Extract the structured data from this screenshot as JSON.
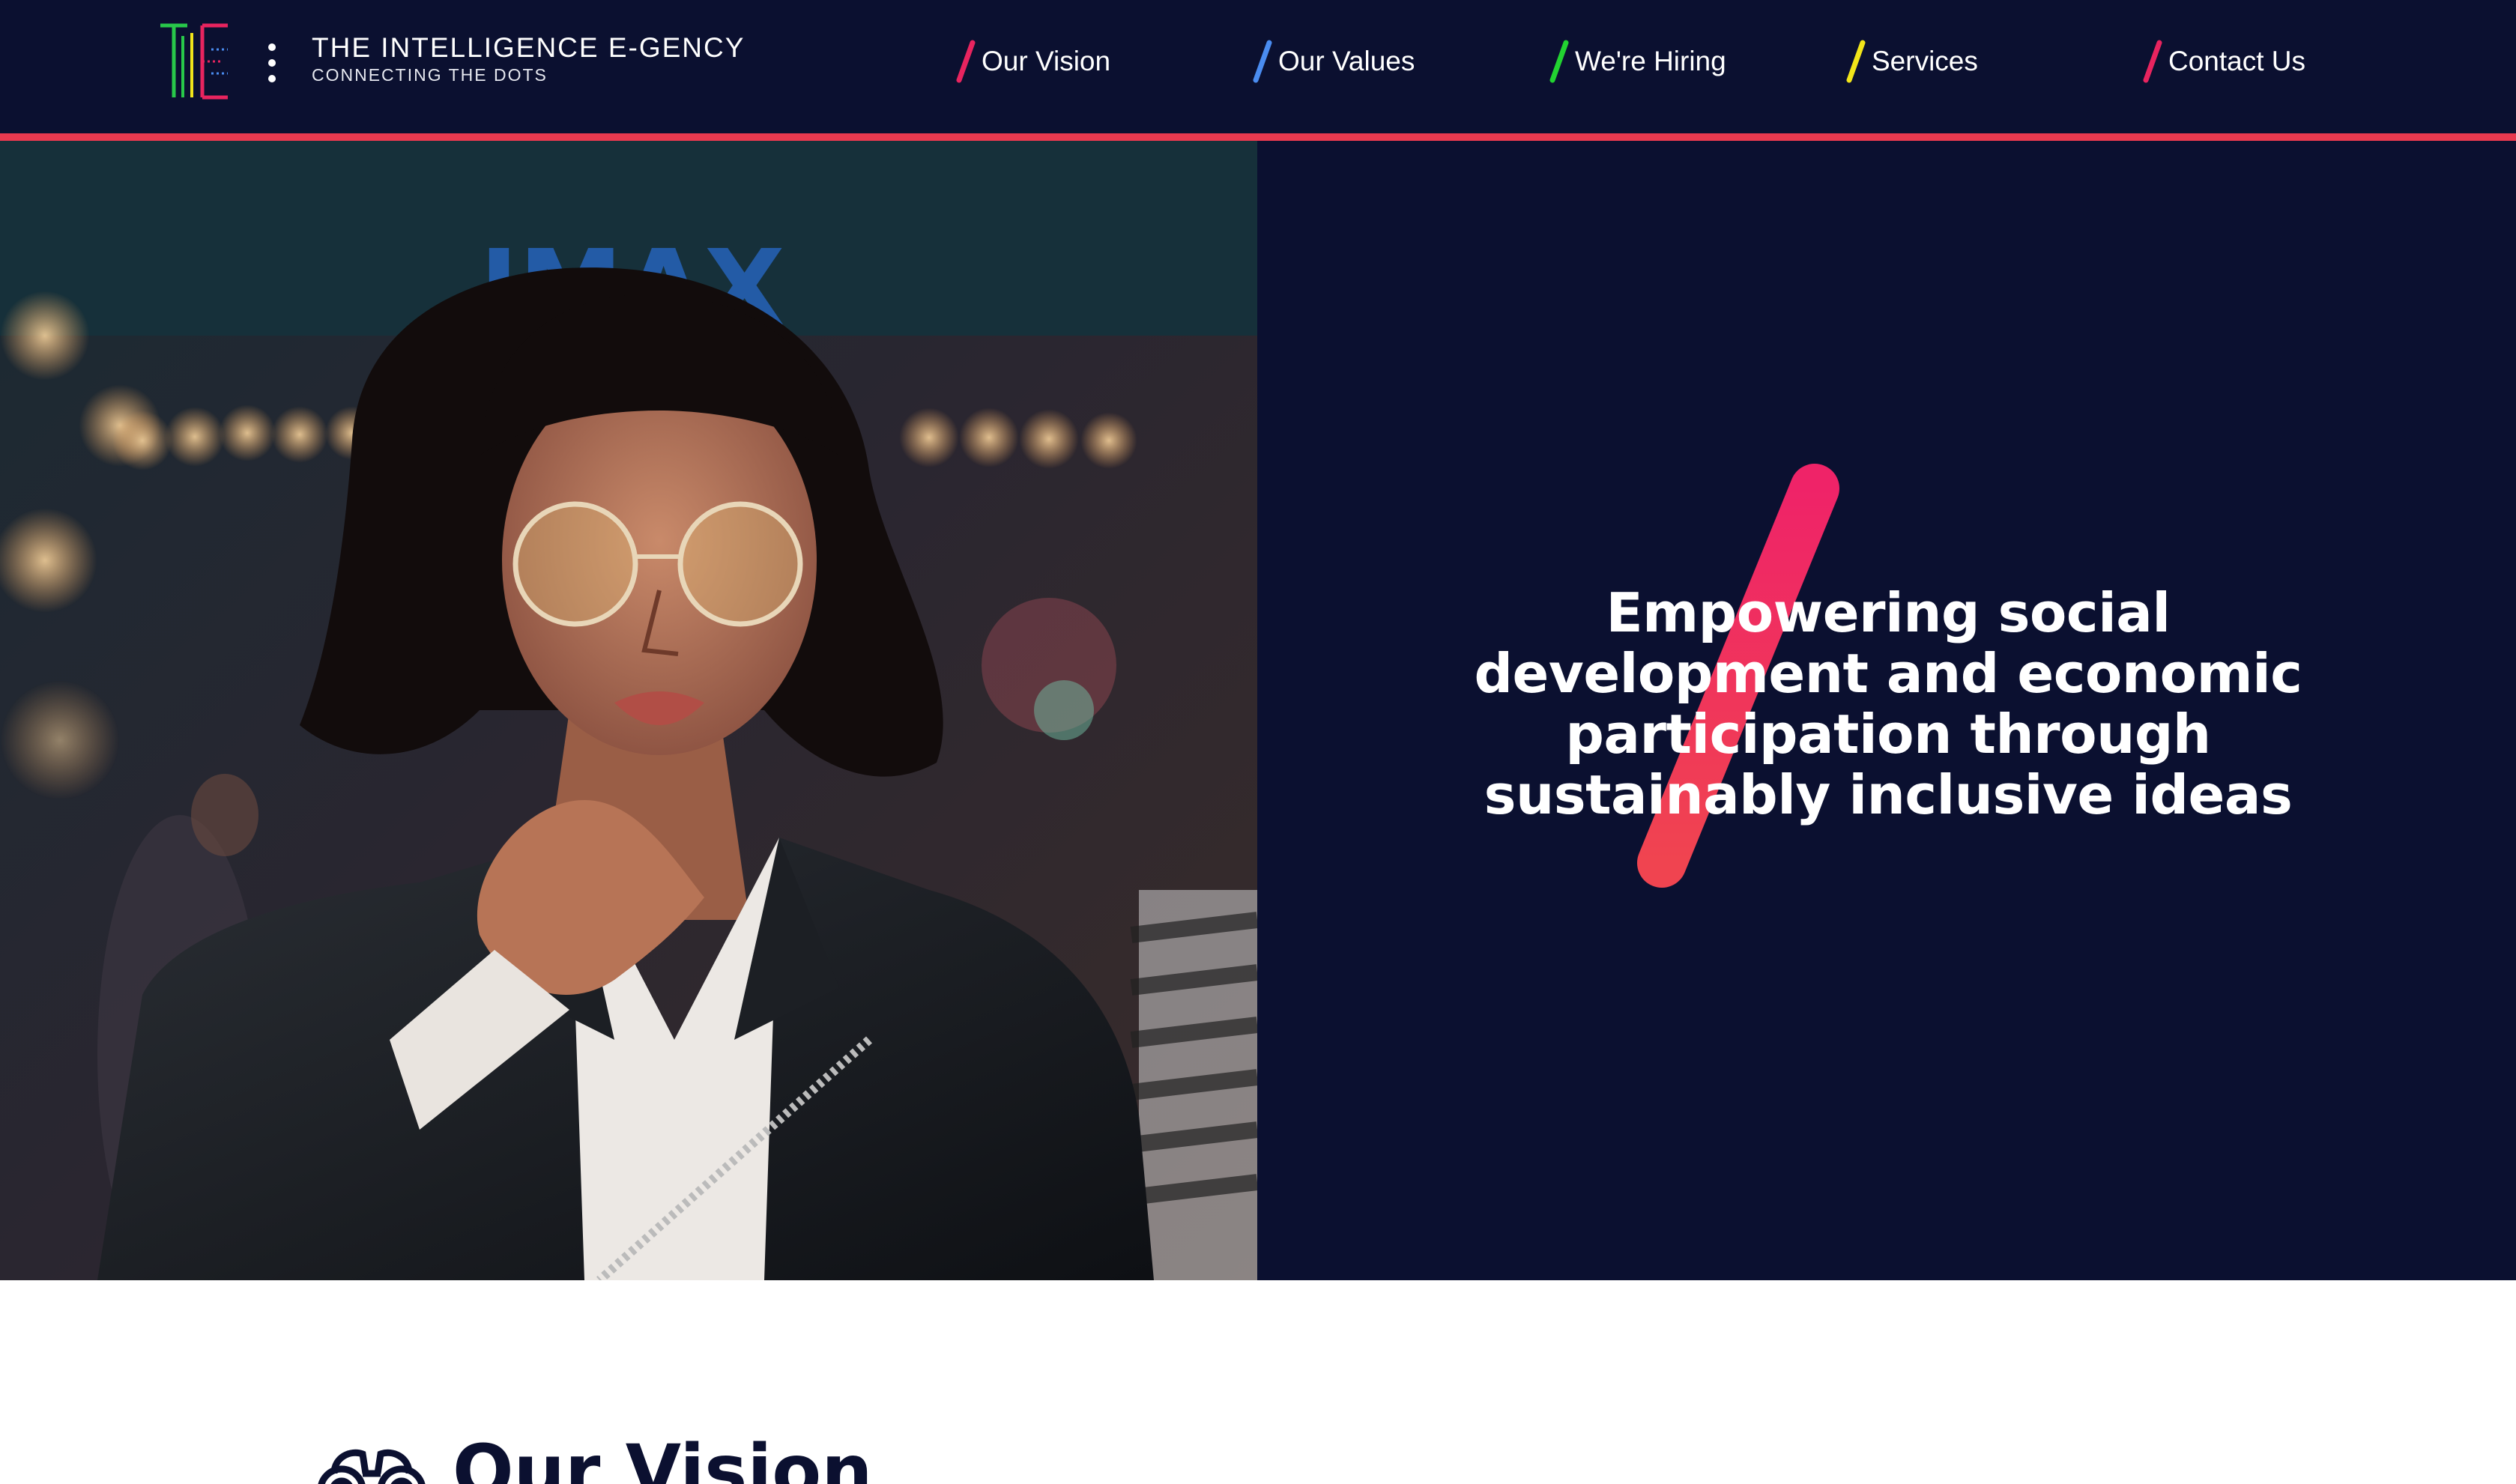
{
  "header": {
    "brand_name": "THE INTELLIGENCE E-GENCY",
    "brand_tagline": "CONNECTING THE DOTS",
    "logo_icon": "te-monogram-logo",
    "menu_icon": "vertical-dots-icon"
  },
  "nav": [
    {
      "label": "Our Vision",
      "color": "#e8245f"
    },
    {
      "label": "Our Values",
      "color": "#4a8cf0"
    },
    {
      "label": "We're Hiring",
      "color": "#22d331"
    },
    {
      "label": "Services",
      "color": "#f2e51a"
    },
    {
      "label": "Contact Us",
      "color": "#e8245f"
    }
  ],
  "hero": {
    "headline_lines": [
      "Empowering social",
      "development and economic",
      "participation through",
      "sustainably inclusive ideas"
    ],
    "slash_color": "#ef2c61",
    "image": "woman-with-glasses-city-night-photo"
  },
  "vision": {
    "title": "Our Vision",
    "icon": "binoculars-icon"
  },
  "colors": {
    "navy": "#0b1030",
    "accent_red": "#e8394f"
  }
}
